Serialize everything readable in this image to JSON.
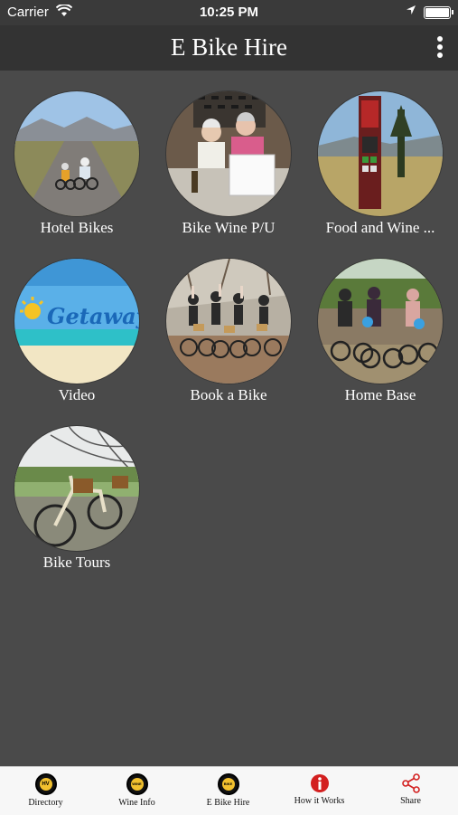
{
  "status": {
    "carrier": "Carrier",
    "time": "10:25 PM"
  },
  "nav": {
    "title": "E Bike Hire"
  },
  "tiles": [
    {
      "label": "Hotel Bikes"
    },
    {
      "label": "Bike Wine P/U"
    },
    {
      "label": "Food and Wine ..."
    },
    {
      "label": "Video",
      "image_text": "Getaway"
    },
    {
      "label": "Book a Bike"
    },
    {
      "label": "Home Base"
    },
    {
      "label": "Bike Tours"
    }
  ],
  "tabs": [
    {
      "label": "Directory",
      "icon": "hv-badge-icon",
      "badge": "HV"
    },
    {
      "label": "Wine Info",
      "icon": "wine-badge-icon",
      "badge": "WINE"
    },
    {
      "label": "E Bike Hire",
      "icon": "bike-badge-icon",
      "badge": "BIKE"
    },
    {
      "label": "How it Works",
      "icon": "info-icon",
      "color": "#d32020"
    },
    {
      "label": "Share",
      "icon": "share-icon",
      "color": "#d32020"
    }
  ]
}
